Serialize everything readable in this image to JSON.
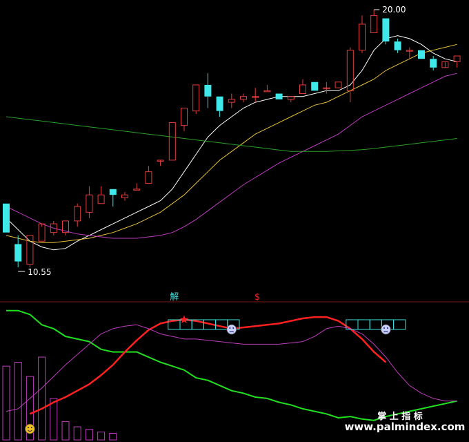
{
  "chart_data": [
    {
      "type": "candlestick",
      "panel": "price",
      "annotations": {
        "high_label": "20.00",
        "low_label": "10.55"
      },
      "ylim": [
        9.9,
        20.5
      ],
      "candles": [
        {
          "o": 13.3,
          "h": 13.3,
          "c": 12.3,
          "l": 12.3
        },
        {
          "o": 11.9,
          "h": 12.2,
          "c": 11.3,
          "l": 11.1
        },
        {
          "o": 11.2,
          "h": 12.2,
          "c": 12.2,
          "l": 11.1
        },
        {
          "o": 12.0,
          "h": 12.5,
          "c": 12.6,
          "l": 12.0
        },
        {
          "o": 12.3,
          "h": 12.7,
          "c": 12.6,
          "l": 12.2
        },
        {
          "o": 12.3,
          "h": 12.7,
          "c": 12.7,
          "l": 12.2
        },
        {
          "o": 12.7,
          "h": 13.3,
          "c": 13.2,
          "l": 12.5
        },
        {
          "o": 13.0,
          "h": 13.9,
          "c": 13.6,
          "l": 12.8
        },
        {
          "o": 13.3,
          "h": 13.9,
          "c": 13.6,
          "l": 13.3
        },
        {
          "o": 13.8,
          "h": 13.8,
          "c": 13.6,
          "l": 13.2
        },
        {
          "o": 13.5,
          "h": 13.7,
          "c": 13.6,
          "l": 13.4
        },
        {
          "o": 13.8,
          "h": 14.0,
          "c": 13.8,
          "l": 13.8
        },
        {
          "o": 14.0,
          "h": 14.6,
          "c": 14.4,
          "l": 14.0
        },
        {
          "o": 14.8,
          "h": 14.8,
          "c": 14.8,
          "l": 14.6
        },
        {
          "o": 14.8,
          "h": 16.1,
          "c": 16.1,
          "l": 14.8
        },
        {
          "o": 16.0,
          "h": 16.6,
          "c": 16.6,
          "l": 15.8
        },
        {
          "o": 16.5,
          "h": 17.4,
          "c": 17.4,
          "l": 16.4
        },
        {
          "o": 17.4,
          "h": 17.8,
          "c": 17.0,
          "l": 16.6
        },
        {
          "o": 17.0,
          "h": 17.0,
          "c": 16.5,
          "l": 16.3
        },
        {
          "o": 16.8,
          "h": 17.1,
          "c": 16.9,
          "l": 16.6
        },
        {
          "o": 16.9,
          "h": 17.1,
          "c": 17.0,
          "l": 16.8
        },
        {
          "o": 17.0,
          "h": 17.3,
          "c": 17.0,
          "l": 16.8
        },
        {
          "o": 17.2,
          "h": 17.4,
          "c": 17.2,
          "l": 17.2
        },
        {
          "o": 17.1,
          "h": 17.1,
          "c": 16.9,
          "l": 16.9
        },
        {
          "o": 16.9,
          "h": 17.0,
          "c": 17.0,
          "l": 16.8
        },
        {
          "o": 17.1,
          "h": 17.6,
          "c": 17.4,
          "l": 17.1
        },
        {
          "o": 17.5,
          "h": 17.5,
          "c": 17.2,
          "l": 17.2
        },
        {
          "o": 17.3,
          "h": 17.5,
          "c": 17.3,
          "l": 17.1
        },
        {
          "o": 17.3,
          "h": 17.5,
          "c": 17.5,
          "l": 17.3
        },
        {
          "o": 17.2,
          "h": 18.7,
          "c": 18.6,
          "l": 16.8
        },
        {
          "o": 18.6,
          "h": 19.8,
          "c": 19.5,
          "l": 18.5
        },
        {
          "o": 19.2,
          "h": 20.0,
          "c": 19.8,
          "l": 19.2
        },
        {
          "o": 19.7,
          "h": 19.7,
          "c": 18.9,
          "l": 18.8
        },
        {
          "o": 18.9,
          "h": 19.0,
          "c": 18.6,
          "l": 18.5
        },
        {
          "o": 18.6,
          "h": 18.7,
          "c": 18.6,
          "l": 18.3
        },
        {
          "o": 18.6,
          "h": 18.6,
          "c": 18.3,
          "l": 18.3
        },
        {
          "o": 18.3,
          "h": 18.4,
          "c": 18.0,
          "l": 17.9
        },
        {
          "o": 18.0,
          "h": 18.0,
          "c": 18.2,
          "l": 18.0
        },
        {
          "o": 18.2,
          "h": 18.4,
          "c": 18.4,
          "l": 18.0
        }
      ],
      "ma_lines": [
        {
          "color": "#ffffff",
          "values": [
            12.8,
            12.4,
            12.0,
            11.8,
            11.7,
            11.75,
            12.0,
            12.2,
            12.4,
            12.6,
            12.8,
            13.0,
            13.2,
            13.4,
            13.8,
            14.4,
            15.0,
            15.6,
            16.0,
            16.3,
            16.6,
            16.8,
            16.9,
            17.0,
            17.0,
            17.0,
            17.1,
            17.2,
            17.2,
            17.4,
            17.9,
            18.6,
            19.0,
            19.1,
            19.0,
            18.8,
            18.5,
            18.3,
            18.2
          ]
        },
        {
          "color": "#e8c23a",
          "values": [
            12.2,
            12.1,
            12.0,
            11.95,
            11.95,
            12.0,
            12.05,
            12.1,
            12.2,
            12.3,
            12.45,
            12.6,
            12.8,
            13.0,
            13.3,
            13.6,
            14.0,
            14.4,
            14.8,
            15.1,
            15.4,
            15.7,
            15.9,
            16.1,
            16.3,
            16.5,
            16.7,
            16.8,
            17.0,
            17.2,
            17.4,
            17.6,
            17.9,
            18.1,
            18.3,
            18.5,
            18.6,
            18.7,
            18.8
          ]
        },
        {
          "color": "#c03cc0",
          "values": [
            13.2,
            13.0,
            12.8,
            12.6,
            12.45,
            12.35,
            12.25,
            12.2,
            12.15,
            12.1,
            12.1,
            12.1,
            12.15,
            12.2,
            12.3,
            12.5,
            12.75,
            13.05,
            13.35,
            13.65,
            13.95,
            14.2,
            14.45,
            14.7,
            14.9,
            15.1,
            15.3,
            15.5,
            15.7,
            16.0,
            16.3,
            16.5,
            16.7,
            16.9,
            17.1,
            17.3,
            17.5,
            17.7,
            17.8
          ]
        },
        {
          "color": "#2aa02a",
          "values": [
            16.3,
            16.25,
            16.2,
            16.15,
            16.1,
            16.05,
            16.0,
            15.95,
            15.9,
            15.85,
            15.8,
            15.75,
            15.7,
            15.65,
            15.6,
            15.55,
            15.5,
            15.45,
            15.4,
            15.35,
            15.3,
            15.25,
            15.2,
            15.15,
            15.1,
            15.1,
            15.1,
            15.1,
            15.12,
            15.14,
            15.16,
            15.2,
            15.25,
            15.3,
            15.35,
            15.4,
            15.45,
            15.5,
            15.55
          ]
        }
      ],
      "markers": [
        {
          "text": "解",
          "color": "#3fe0e0",
          "bar": 14
        },
        {
          "text": "$",
          "color": "#ff2020",
          "bar": 21
        }
      ]
    },
    {
      "type": "line",
      "panel": "indicator",
      "ylim": [
        0,
        100
      ],
      "series": [
        {
          "color": "#20e020",
          "width": 2,
          "values": [
            98,
            98,
            95,
            87,
            84,
            78,
            76,
            74,
            68,
            66,
            66,
            66,
            62,
            58,
            55,
            52,
            46,
            44,
            40,
            36,
            34,
            31,
            30,
            27,
            25,
            22,
            20,
            18,
            15,
            16,
            14,
            13,
            16,
            18,
            20,
            22,
            24,
            26,
            28
          ]
        },
        {
          "color": "#ff2020",
          "width": 2.5,
          "values": [
            null,
            null,
            18,
            22,
            27,
            31,
            36,
            41,
            48,
            56,
            66,
            75,
            83,
            88,
            90,
            91,
            90,
            88,
            86,
            84,
            85,
            86,
            87,
            88,
            90,
            92,
            93,
            93,
            90,
            84,
            76,
            66,
            58,
            null,
            null,
            null,
            null,
            null,
            null
          ]
        },
        {
          "color": "#c03cc0",
          "width": 1,
          "values": [
            20,
            22,
            30,
            38,
            47,
            56,
            64,
            72,
            80,
            84,
            86,
            87,
            84,
            80,
            78,
            76,
            76,
            75,
            74,
            73,
            72,
            72,
            72,
            72,
            73,
            74,
            78,
            84,
            86,
            84,
            80,
            72,
            62,
            50,
            40,
            34,
            30,
            28,
            28
          ]
        }
      ],
      "bars": {
        "color": "#c03cc0",
        "values": [
          55,
          58,
          47,
          62,
          30,
          12,
          8,
          6,
          4,
          3,
          0,
          0,
          0,
          0,
          0,
          0,
          0,
          0,
          0,
          0,
          0,
          0,
          0,
          0,
          0,
          0,
          0,
          0,
          0,
          0,
          0,
          0,
          0,
          0,
          0,
          0,
          0,
          0,
          0
        ]
      },
      "star_bar": 15,
      "faces": [
        {
          "bar": 19,
          "kind": "sad"
        },
        {
          "bar": 32,
          "kind": "sad"
        },
        {
          "bar": 2,
          "kind": "happy"
        }
      ],
      "boxes": [
        {
          "start": 14,
          "count": 6
        },
        {
          "start": 29,
          "count": 5
        }
      ]
    }
  ],
  "watermark": {
    "line1": "掌 上 指 标",
    "line2": "www.palmindex.com"
  },
  "colors": {
    "up": "#e63c3c",
    "down": "#3fe9e9",
    "separator": "#7a1a1a",
    "box": "#3fe0e0"
  }
}
